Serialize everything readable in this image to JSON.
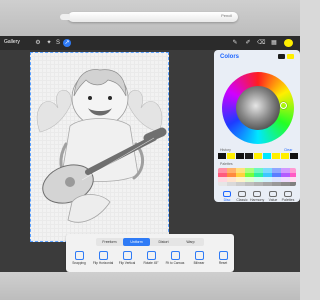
{
  "pencil": {
    "label": "Pencil"
  },
  "toolbar": {
    "gallery": "Gallery"
  },
  "colors_panel": {
    "title": "Colors",
    "history_label": "History",
    "clear_label": "Clear",
    "palette_label": "Palettes",
    "tabs": [
      {
        "label": "Disc"
      },
      {
        "label": "Classic"
      },
      {
        "label": "Harmony"
      },
      {
        "label": "Value"
      },
      {
        "label": "Palettes"
      }
    ]
  },
  "transform": {
    "modes": [
      {
        "label": "Freeform"
      },
      {
        "label": "Uniform"
      },
      {
        "label": "Distort"
      },
      {
        "label": "Warp"
      }
    ],
    "actions": [
      {
        "label": "Snapping"
      },
      {
        "label": "Flip Horizontal"
      },
      {
        "label": "Flip Vertical"
      },
      {
        "label": "Rotate 45°"
      },
      {
        "label": "Fit to Canvas"
      },
      {
        "label": "Bilinear"
      },
      {
        "label": "Reset"
      }
    ]
  },
  "colors": {
    "accent": "#2f7bf6",
    "title": "#1e66ff"
  }
}
